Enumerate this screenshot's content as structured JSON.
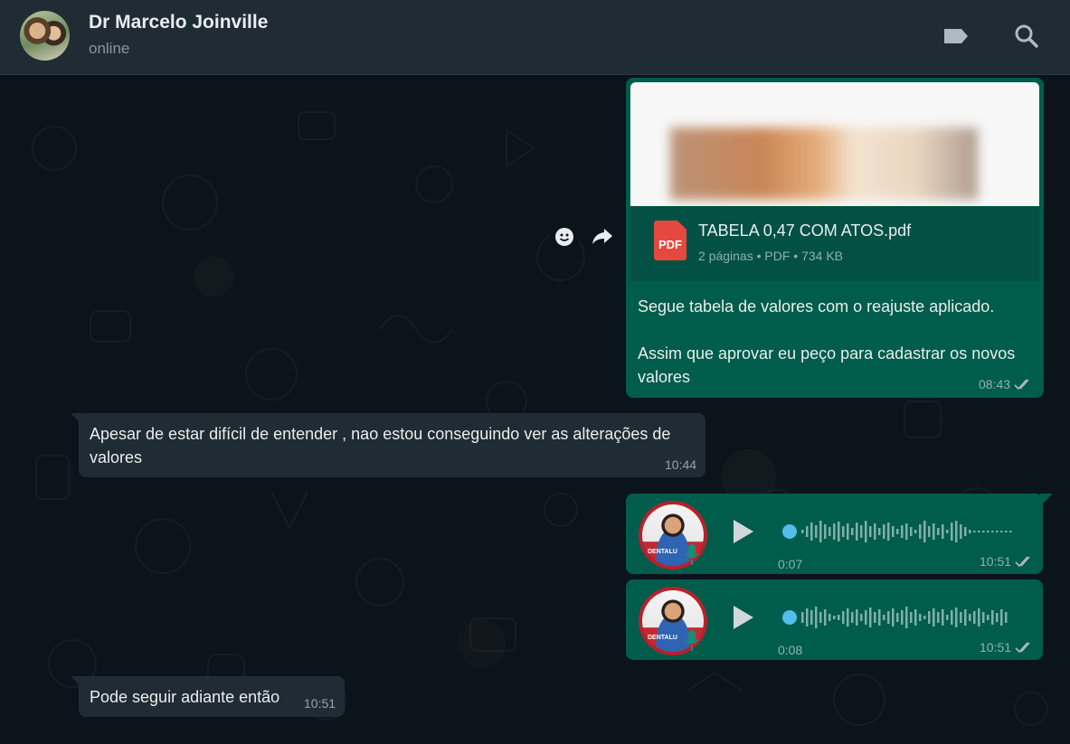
{
  "header": {
    "contact_name": "Dr Marcelo Joinville",
    "status": "online",
    "icons": [
      "avatar",
      "label-icon",
      "search-icon"
    ]
  },
  "messages": {
    "doc": {
      "file_name": "TABELA 0,47 COM ATOS.pdf",
      "file_info": "2 páginas • PDF • 734 KB",
      "pdf_badge": "PDF",
      "caption_line1": "Segue tabela de valores com o reajuste aplicado.",
      "caption_line2": "Assim que aprovar eu peço para cadastrar os novos valores",
      "time": "08:43",
      "status": "read"
    },
    "incoming1": {
      "text": "Apesar de estar difícil de entender , nao estou conseguindo ver as alterações de valores",
      "time": "10:44"
    },
    "voice1": {
      "duration": "0:07",
      "time": "10:51",
      "status": "read",
      "brand": "DENTALU"
    },
    "voice2": {
      "duration": "0:08",
      "time": "10:51",
      "status": "read",
      "brand": "DENTALU"
    },
    "incoming2": {
      "text": "Pode seguir adiante então",
      "time": "10:51"
    }
  },
  "colors": {
    "header_bg": "#202c33",
    "chat_bg": "#0b141a",
    "outgoing_bubble": "#005c4b",
    "incoming_bubble": "#202c33",
    "accent": "#53bdeb"
  }
}
